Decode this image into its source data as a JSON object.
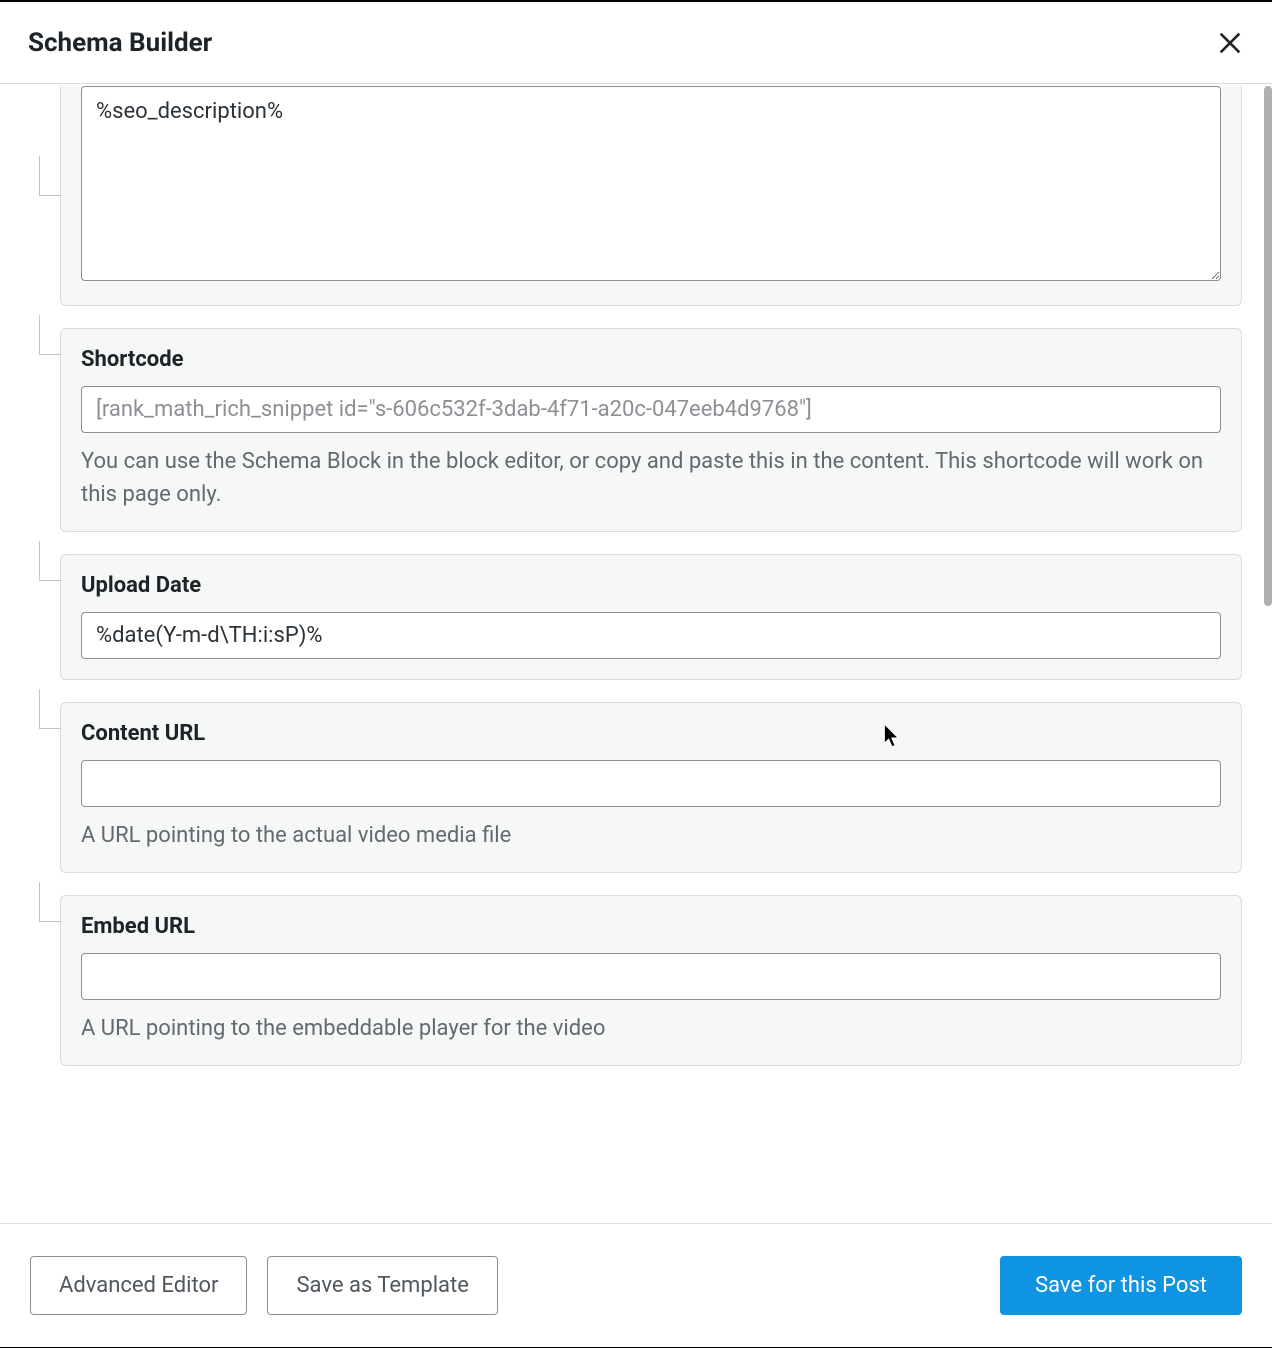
{
  "header": {
    "title": "Schema Builder"
  },
  "fields": {
    "description": {
      "value": "%seo_description%"
    },
    "shortcode": {
      "label": "Shortcode",
      "value": "[rank_math_rich_snippet id=\"s-606c532f-3dab-4f71-a20c-047eeb4d9768\"]",
      "help": "You can use the Schema Block in the block editor, or copy and paste this in the content. This shortcode will work on this page only."
    },
    "upload_date": {
      "label": "Upload Date",
      "value": "%date(Y-m-d\\TH:i:sP)%"
    },
    "content_url": {
      "label": "Content URL",
      "value": "",
      "help": "A URL pointing to the actual video media file"
    },
    "embed_url": {
      "label": "Embed URL",
      "value": "",
      "help": "A URL pointing to the embeddable player for the video"
    }
  },
  "footer": {
    "advanced_editor": "Advanced Editor",
    "save_as_template": "Save as Template",
    "save_for_post": "Save for this Post"
  }
}
